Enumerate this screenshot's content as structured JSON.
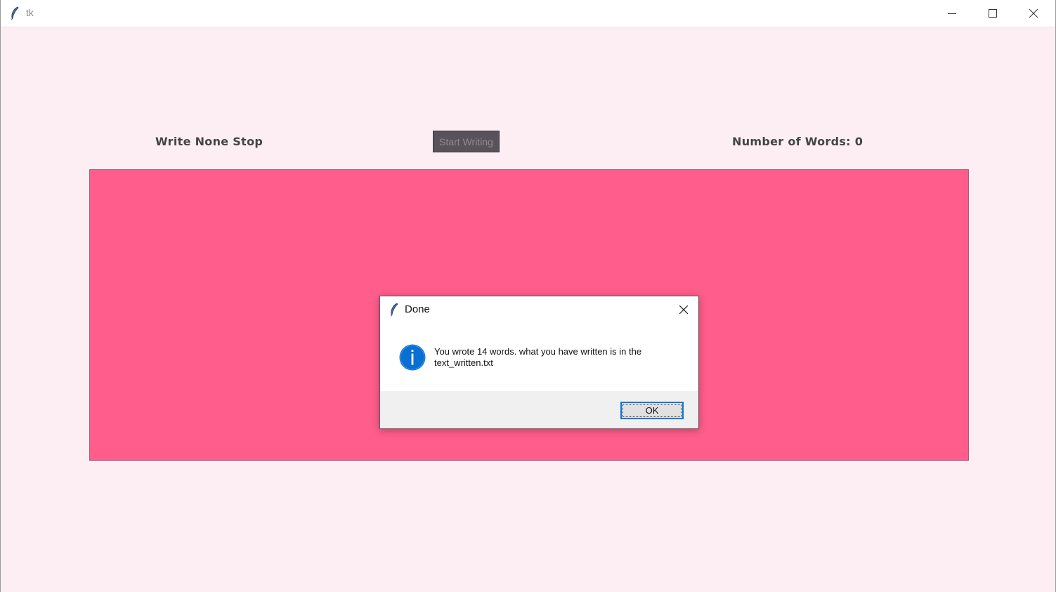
{
  "window": {
    "title": "tk",
    "app_icon": "feather-icon",
    "controls": [
      "minimize-icon",
      "maximize-icon",
      "close-icon"
    ]
  },
  "app": {
    "heading": "Write None Stop",
    "start_button_label": "Start Writing",
    "word_count_label": "Number of Words: 0",
    "text_area_value": ""
  },
  "dialog": {
    "title": "Done",
    "icon": "info-icon",
    "message": "You wrote 14 words. what you have written is in the text_written.txt",
    "ok_label": "OK"
  },
  "colors": {
    "background": "#fdeef4",
    "text_area": "#ff5d8b",
    "button_bg": "#58535a",
    "info_blue": "#0a6fd3"
  }
}
